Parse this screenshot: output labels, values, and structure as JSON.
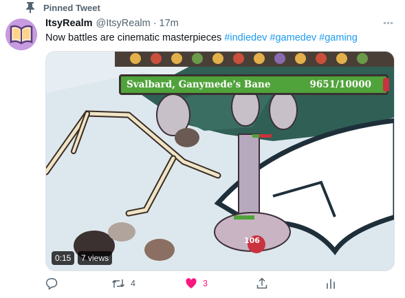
{
  "pinned_label": "Pinned Tweet",
  "tweet": {
    "display_name": "ItsyRealm",
    "handle": "@ItsyRealm",
    "separator": "·",
    "time": "17m",
    "text": "Now battles are cinematic masterpieces",
    "hashtags": [
      "#indiedev",
      "#gamedev",
      "#gaming"
    ]
  },
  "media": {
    "boss_name": "Svalbard, Ganymede's Bane",
    "boss_health": "9651/10000",
    "damage_number": "106",
    "timestamp": "0:15",
    "views": "7 views"
  },
  "actions": {
    "reply_count": "",
    "retweet_count": "4",
    "like_count": "3",
    "share_count": "",
    "analytics_count": ""
  },
  "colors": {
    "link": "#1d9bf0",
    "like": "#f91880",
    "secondary": "#536471",
    "boss_bar": "#4fa33a"
  },
  "icons": [
    "pin-icon",
    "more-icon",
    "reply-icon",
    "retweet-icon",
    "heart-icon",
    "share-icon",
    "analytics-icon"
  ]
}
